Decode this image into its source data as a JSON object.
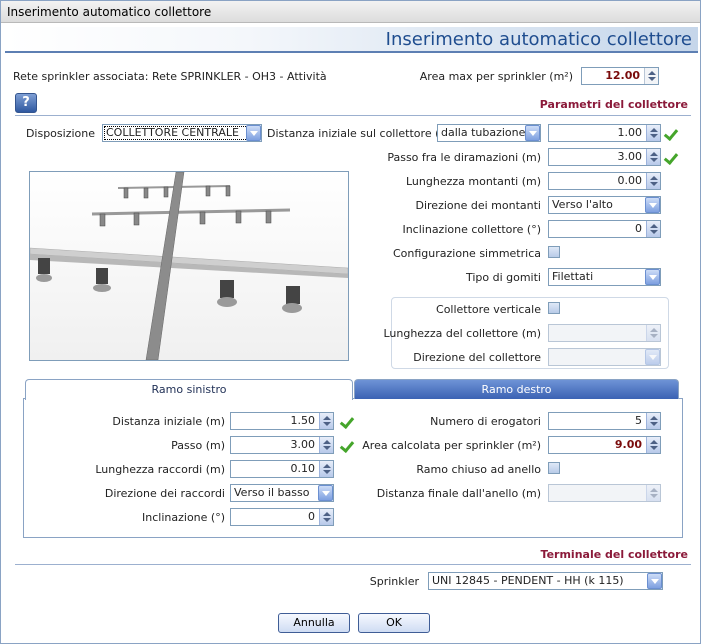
{
  "window": {
    "title": "Inserimento automatico collettore",
    "banner_title": "Inserimento automatico collettore"
  },
  "header": {
    "rete_label": "Rete sprinkler associata: Rete SPRINKLER - OH3 - Attività",
    "area_max_label": "Area max per sprinkler (m²)",
    "area_max_value": "12.00"
  },
  "help": {
    "label": "?"
  },
  "parametri": {
    "title": "Parametri del collettore",
    "disposizione_label": "Disposizione",
    "disposizione_value": "COLLETTORE CENTRALE",
    "distanza_iniziale_label": "Distanza iniziale sul collettore (m)",
    "distanza_iniziale_mode": "dalla tubazione",
    "distanza_iniziale_value": "1.00",
    "passo_label": "Passo fra le diramazioni (m)",
    "passo_value": "3.00",
    "lunghezza_montanti_label": "Lunghezza montanti (m)",
    "lunghezza_montanti_value": "0.00",
    "direzione_montanti_label": "Direzione dei montanti",
    "direzione_montanti_value": "Verso l'alto",
    "inclinazione_label": "Inclinazione collettore (°)",
    "inclinazione_value": "0",
    "configurazione_label": "Configurazione simmetrica",
    "tipo_gomiti_label": "Tipo di gomiti",
    "tipo_gomiti_value": "Filettati",
    "collettore_verticale_label": "Collettore verticale",
    "lunghezza_collettore_label": "Lunghezza del collettore (m)",
    "direzione_collettore_label": "Direzione del collettore"
  },
  "tabs": {
    "left": "Ramo sinistro",
    "right": "Ramo destro"
  },
  "ramo": {
    "distanza_iniziale_label": "Distanza iniziale (m)",
    "distanza_iniziale_value": "1.50",
    "passo_label": "Passo (m)",
    "passo_value": "3.00",
    "lunghezza_raccordi_label": "Lunghezza raccordi (m)",
    "lunghezza_raccordi_value": "0.10",
    "direzione_raccordi_label": "Direzione dei raccordi",
    "direzione_raccordi_value": "Verso il basso",
    "inclinazione_label": "Inclinazione (°)",
    "inclinazione_value": "0",
    "numero_erogatori_label": "Numero di erogatori",
    "numero_erogatori_value": "5",
    "area_calcolata_label": "Area calcolata per sprinkler (m²)",
    "area_calcolata_value": "9.00",
    "ramo_chiuso_label": "Ramo chiuso ad anello",
    "distanza_finale_label": "Distanza finale dall'anello (m)"
  },
  "terminale": {
    "title": "Terminale del collettore",
    "sprinkler_label": "Sprinkler",
    "sprinkler_value": "UNI 12845 - PENDENT - HH (k 115)"
  },
  "buttons": {
    "annulla": "Annulla",
    "ok": "OK"
  },
  "colors": {
    "accent_red": "#8b1a3a",
    "banner_blue": "#1f4d8f",
    "check_green": "#45a52b"
  }
}
